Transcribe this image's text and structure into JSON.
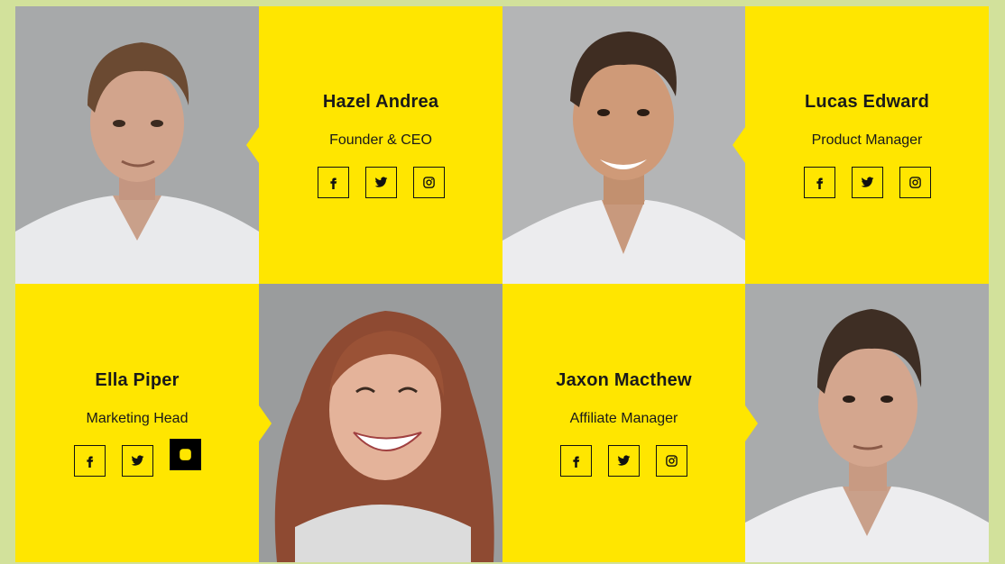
{
  "team": [
    {
      "name": "Hazel Andrea",
      "role": "Founder & CEO",
      "photo": "man-portrait-1",
      "socials": [
        "facebook-icon",
        "twitter-icon",
        "instagram-icon"
      ]
    },
    {
      "name": "Lucas Edward",
      "role": "Product Manager",
      "photo": "man-portrait-2",
      "socials": [
        "facebook-icon",
        "twitter-icon",
        "instagram-icon"
      ]
    },
    {
      "name": "Ella Piper",
      "role": "Marketing Head",
      "photo": "woman-portrait",
      "socials": [
        "facebook-icon",
        "twitter-icon",
        "instagram-icon"
      ],
      "active_social": "instagram-icon"
    },
    {
      "name": "Jaxon Macthew",
      "role": "Affiliate Manager",
      "photo": "man-portrait-3",
      "socials": [
        "facebook-icon",
        "twitter-icon",
        "instagram-icon"
      ]
    }
  ],
  "colors": {
    "card_bg": "#ffe600",
    "page_bg": "#d2e19b",
    "text": "#1a1a1a",
    "active_social_bg": "#000000"
  }
}
